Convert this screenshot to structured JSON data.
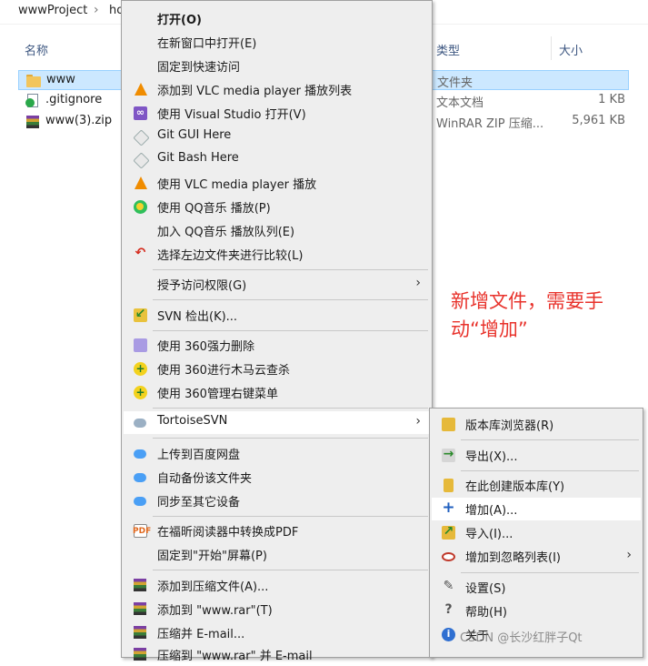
{
  "breadcrumb": {
    "root": "wwwProject",
    "current": "ho"
  },
  "columns": {
    "name": "名称",
    "type": "类型",
    "size": "大小"
  },
  "files": [
    {
      "name": "www",
      "type": "文件夹",
      "size": "",
      "icon": "folder-icon"
    },
    {
      "name": ".gitignore",
      "type": "文本文档",
      "size": "1 KB",
      "icon": "text-file-icon"
    },
    {
      "name": "www(3).zip",
      "type": "WinRAR ZIP 压缩...",
      "size": "5,961 KB",
      "icon": "winrar-zip-icon"
    }
  ],
  "context_menu": {
    "items": [
      {
        "label": "打开(O)",
        "icon": ""
      },
      {
        "label": "在新窗口中打开(E)",
        "icon": ""
      },
      {
        "label": "固定到快速访问",
        "icon": ""
      },
      {
        "label": "添加到 VLC media player 播放列表",
        "icon": "vlc-icon"
      },
      {
        "label": "使用 Visual Studio 打开(V)",
        "icon": "visual-studio-icon"
      },
      {
        "label": "Git GUI Here",
        "icon": "git-icon"
      },
      {
        "label": "Git Bash Here",
        "icon": "git-icon"
      },
      {
        "label": "使用 VLC media player 播放",
        "icon": "vlc-icon"
      },
      {
        "label": "使用 QQ音乐 播放(P)",
        "icon": "qq-music-icon"
      },
      {
        "label": "加入 QQ音乐 播放队列(E)",
        "icon": ""
      },
      {
        "label": "选择左边文件夹进行比较(L)",
        "icon": "compare-icon"
      },
      {
        "label": "授予访问权限(G)",
        "icon": ""
      },
      {
        "label": "SVN 检出(K)...",
        "icon": "svn-checkout-icon"
      },
      {
        "label": "使用 360强力删除",
        "icon": "360-delete-icon"
      },
      {
        "label": "使用 360进行木马云查杀",
        "icon": "360-scan-icon"
      },
      {
        "label": "使用 360管理右键菜单",
        "icon": "360-manage-icon"
      },
      {
        "label": "TortoiseSVN",
        "icon": "tortoisesvn-icon"
      },
      {
        "label": "上传到百度网盘",
        "icon": "baidu-netdisk-icon"
      },
      {
        "label": "自动备份该文件夹",
        "icon": "baidu-netdisk-icon"
      },
      {
        "label": "同步至其它设备",
        "icon": "baidu-netdisk-icon"
      },
      {
        "label": "在福昕阅读器中转换成PDF",
        "icon": "foxit-pdf-icon"
      },
      {
        "label": "固定到\"开始\"屏幕(P)",
        "icon": ""
      },
      {
        "label": "添加到压缩文件(A)...",
        "icon": "winrar-icon"
      },
      {
        "label": "添加到 \"www.rar\"(T)",
        "icon": "winrar-icon"
      },
      {
        "label": "压缩并 E-mail...",
        "icon": "winrar-icon"
      },
      {
        "label": "压缩到 \"www.rar\" 并 E-mail",
        "icon": "winrar-icon"
      }
    ]
  },
  "submenu": {
    "items": [
      {
        "label": "版本库浏览器(R)",
        "icon": "repo-browser-icon"
      },
      {
        "label": "导出(X)...",
        "icon": "export-icon"
      },
      {
        "label": "在此创建版本库(Y)",
        "icon": "create-repo-icon"
      },
      {
        "label": "增加(A)...",
        "icon": "add-plus-icon"
      },
      {
        "label": "导入(I)...",
        "icon": "import-icon"
      },
      {
        "label": "增加到忽略列表(I)",
        "icon": "ignore-list-icon"
      },
      {
        "label": "设置(S)",
        "icon": "settings-icon"
      },
      {
        "label": "帮助(H)",
        "icon": "help-icon"
      },
      {
        "label": "关于",
        "icon": "about-icon"
      }
    ]
  },
  "annotation": {
    "line1": "新增文件，需要手",
    "line2": "动“增加”"
  },
  "watermark": "CSDN @长沙红胖子Qt",
  "colors": {
    "highlight": "#ffffff",
    "menu_bg": "#eeeeee",
    "selection": "#cce8ff",
    "annotation": "#e8322b"
  }
}
